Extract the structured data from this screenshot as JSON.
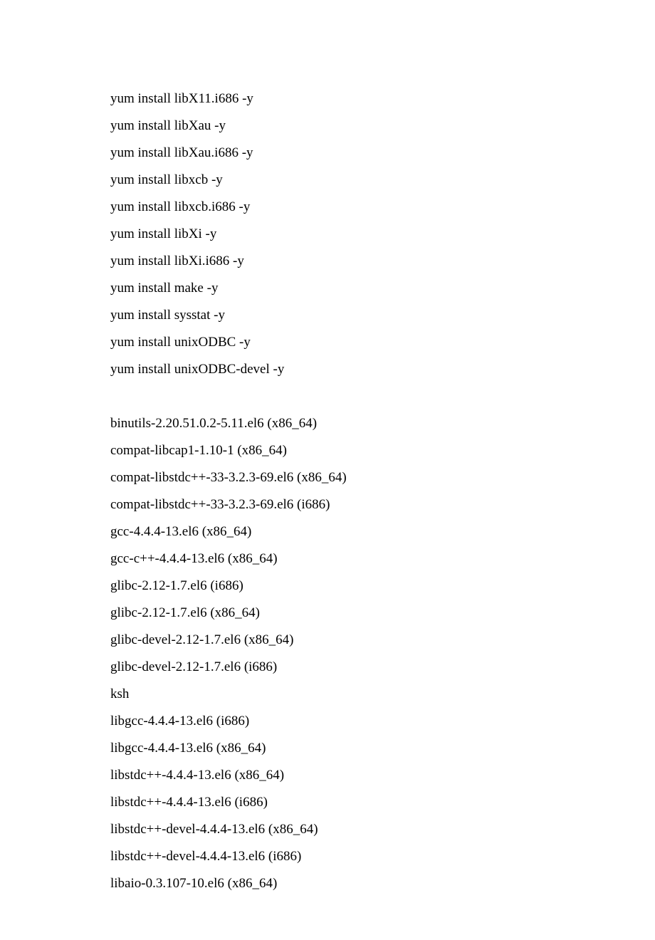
{
  "commands": [
    "yum install libX11.i686 -y",
    "yum install libXau -y",
    "yum install libXau.i686 -y",
    "yum install libxcb -y",
    "yum install libxcb.i686 -y",
    "yum install libXi -y",
    "yum install libXi.i686 -y",
    "yum install make -y",
    "yum install sysstat -y",
    "yum install unixODBC -y",
    "yum install unixODBC-devel -y"
  ],
  "packages": [
    "binutils-2.20.51.0.2-5.11.el6 (x86_64)",
    "compat-libcap1-1.10-1 (x86_64)",
    "compat-libstdc++-33-3.2.3-69.el6 (x86_64)",
    "compat-libstdc++-33-3.2.3-69.el6 (i686)",
    "gcc-4.4.4-13.el6 (x86_64)",
    "gcc-c++-4.4.4-13.el6 (x86_64)",
    "glibc-2.12-1.7.el6 (i686)",
    "glibc-2.12-1.7.el6 (x86_64)",
    "glibc-devel-2.12-1.7.el6 (x86_64)",
    "glibc-devel-2.12-1.7.el6 (i686)",
    "ksh",
    "libgcc-4.4.4-13.el6 (i686)",
    "libgcc-4.4.4-13.el6 (x86_64)",
    "libstdc++-4.4.4-13.el6 (x86_64)",
    "libstdc++-4.4.4-13.el6 (i686)",
    "libstdc++-devel-4.4.4-13.el6 (x86_64)",
    "libstdc++-devel-4.4.4-13.el6 (i686)",
    "libaio-0.3.107-10.el6 (x86_64)"
  ]
}
